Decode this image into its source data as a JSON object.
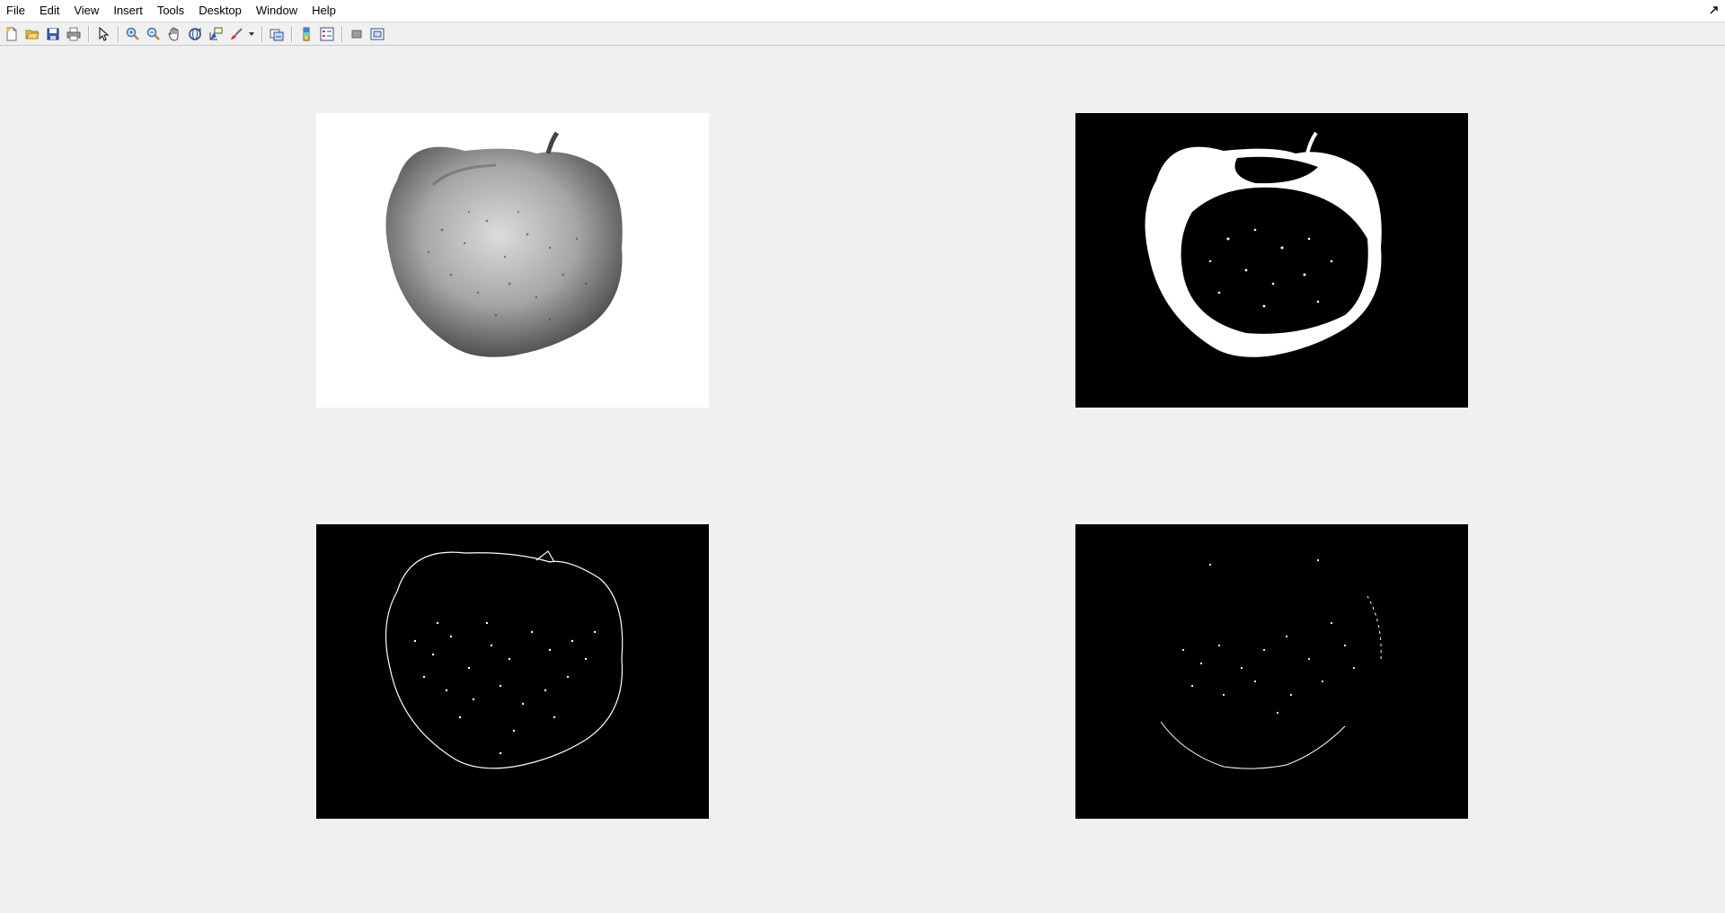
{
  "menu": {
    "items": [
      "File",
      "Edit",
      "View",
      "Insert",
      "Tools",
      "Desktop",
      "Window",
      "Help"
    ]
  },
  "toolbar": {
    "buttons": [
      "new-figure-icon",
      "open-file-icon",
      "save-figure-icon",
      "print-figure-icon",
      "edit-plot-icon",
      "zoom-in-icon",
      "zoom-out-icon",
      "pan-icon",
      "rotate-3d-icon",
      "data-cursor-icon",
      "brush-icon",
      "link-plot-icon",
      "insert-colorbar-icon",
      "insert-legend-icon",
      "hide-plot-tools-icon",
      "show-plot-tools-icon"
    ]
  },
  "figure": {
    "panels": [
      {
        "name": "grayscale-apple-image",
        "background": "#ffffff",
        "foreground": "#7a7a7a"
      },
      {
        "name": "binary-threshold-apple-image",
        "background": "#000000",
        "foreground": "#ffffff"
      },
      {
        "name": "edge-detection-apple-image",
        "background": "#000000",
        "foreground": "#ffffff"
      },
      {
        "name": "edge-detection-sparse-apple-image",
        "background": "#000000",
        "foreground": "#ffffff"
      }
    ]
  }
}
